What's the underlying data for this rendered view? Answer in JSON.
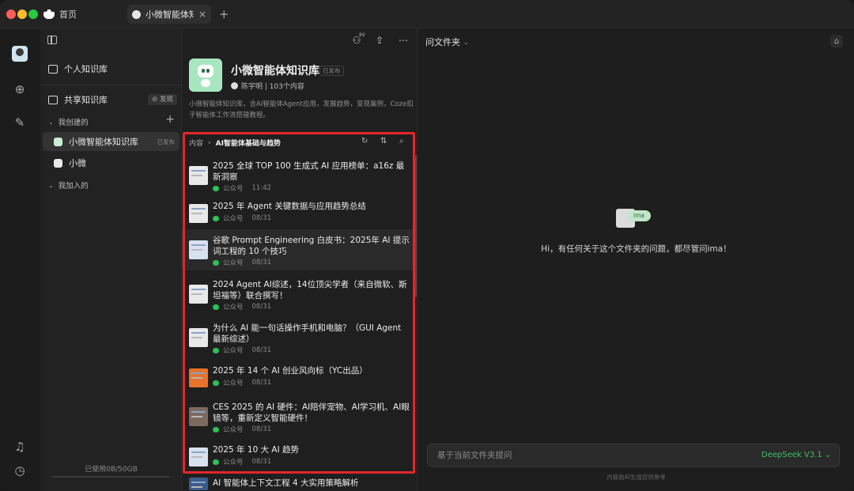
{
  "tabs": {
    "home_label": "首页",
    "active_label": "小微智能体知识库",
    "new_tab": "+",
    "close": "×"
  },
  "sidebar": {
    "personal_kb": "个人知识库",
    "shared_kb": "共享知识库",
    "discover": "⊘ 发现",
    "created_group": "我创建的",
    "add": "+",
    "created_items": [
      {
        "label": "小微智能体知识库",
        "badge": "已发布"
      },
      {
        "label": "小微",
        "badge": ""
      }
    ],
    "joined_group": "我加入的",
    "storage": "已使用0B/50GB"
  },
  "header": {
    "member_count": "89"
  },
  "kb": {
    "title": "小微智能体知识库",
    "status": "已发布",
    "author": "陈宇明 | 103个内容",
    "description": "小微智能体知识库，含AI智能体Agent应用，发展趋势，变现案例，Coze扣子智能体工作流搭建教程。"
  },
  "breadcrumb": {
    "root": "内容",
    "sep": "›",
    "current": "AI智能体基础与趋势"
  },
  "items": [
    {
      "title": "2025 全球 TOP 100 生成式 AI 应用榜单：a16z 最新洞察",
      "source": "公众号",
      "time": "11:42"
    },
    {
      "title": "2025 年 Agent 关键数据与应用趋势总结",
      "source": "公众号",
      "time": "08/31"
    },
    {
      "title": "谷歌 Prompt Engineering 白皮书：2025年 AI 提示词工程的 10 个技巧",
      "source": "公众号",
      "time": "08/31"
    },
    {
      "title": "2024 Agent AI综述，14位顶尖学者（来自微软、斯坦福等）联合撰写！",
      "source": "公众号",
      "time": "08/31"
    },
    {
      "title": "为什么 AI 能一句话操作手机和电脑？（GUI Agent 最新综述）",
      "source": "公众号",
      "time": "08/31"
    },
    {
      "title": "2025 年 14 个 AI 创业风向标（YC出品）",
      "source": "公众号",
      "time": "08/31"
    },
    {
      "title": "CES 2025 的 AI 硬件：AI陪伴宠物、AI学习机、AI眼镜等，重新定义智能硬件！",
      "source": "公众号",
      "time": "08/31"
    },
    {
      "title": "2025 年 10 大 AI 趋势",
      "source": "公众号",
      "time": "08/31"
    },
    {
      "title": "AI 智能体上下文工程 4 大实用策略解析",
      "source": "",
      "time": ""
    }
  ],
  "right": {
    "folder_title": "问文件夹",
    "ima_label": "ima",
    "hint": "Hi，有任何关于这个文件夹的问题，都尽管问ima！",
    "input_placeholder": "基于当前文件夹提问",
    "model": "DeepSeek V3.1",
    "disclaimer": "内容由AI生成仅供参考"
  },
  "colors": {
    "accent_green": "#3ec06a",
    "highlight_red": "#e3262a"
  }
}
